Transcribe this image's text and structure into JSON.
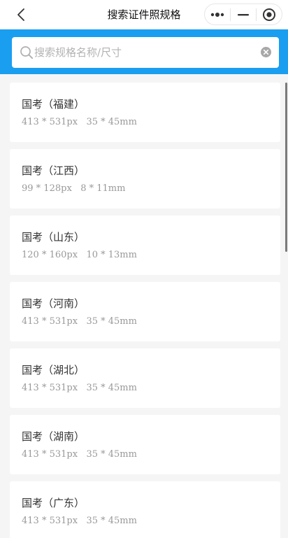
{
  "navbar": {
    "title": "搜索证件照规格",
    "back_icon": "chevron-left-icon",
    "more_icon": "more-dots-icon",
    "minimize_icon": "minimize-icon",
    "close_icon": "target-circle-icon"
  },
  "search": {
    "placeholder": "搜索规格名称/尺寸",
    "value": "",
    "band_color": "#1a9ef0"
  },
  "specs": [
    {
      "name": "国考（福建）",
      "px": "413 * 531px",
      "mm": "35 * 45mm"
    },
    {
      "name": "国考（江西）",
      "px": "99 * 128px",
      "mm": "8 * 11mm"
    },
    {
      "name": "国考（山东）",
      "px": "120 * 160px",
      "mm": "10 * 13mm"
    },
    {
      "name": "国考（河南）",
      "px": "413 * 531px",
      "mm": "35 * 45mm"
    },
    {
      "name": "国考（湖北）",
      "px": "413 * 531px",
      "mm": "35 * 45mm"
    },
    {
      "name": "国考（湖南）",
      "px": "413 * 531px",
      "mm": "35 * 45mm"
    },
    {
      "name": "国考（广东）",
      "px": "413 * 531px",
      "mm": "35 * 45mm"
    }
  ]
}
